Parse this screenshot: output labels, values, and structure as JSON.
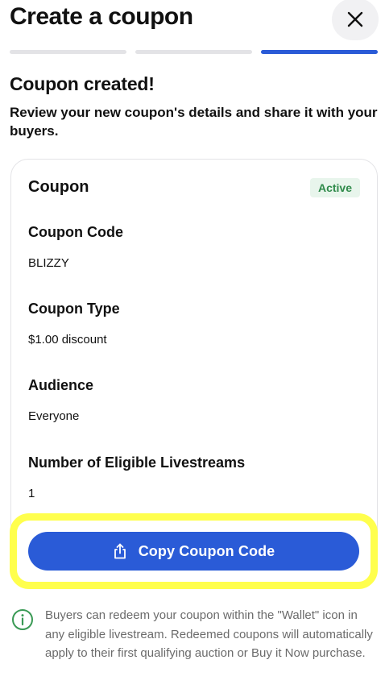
{
  "header": {
    "title": "Create a coupon",
    "close_icon": "close-icon"
  },
  "progress": {
    "total_steps": 3,
    "current_step": 3
  },
  "success": {
    "title": "Coupon created!",
    "description": "Review your new coupon's details and share it with your buyers."
  },
  "coupon": {
    "heading": "Coupon",
    "status": "Active",
    "fields": [
      {
        "label": "Coupon Code",
        "value": "BLIZZY"
      },
      {
        "label": "Coupon Type",
        "value": "$1.00 discount"
      },
      {
        "label": "Audience",
        "value": "Everyone"
      },
      {
        "label": "Number of Eligible Livestreams",
        "value": "1"
      }
    ]
  },
  "copy_button": {
    "label": "Copy Coupon Code",
    "icon": "share-icon"
  },
  "info": {
    "icon": "info-icon",
    "text": "Buyers can redeem your coupon within the \"Wallet\" icon in any eligible livestream. Redeemed coupons will automatically apply to their first qualifying auction or Buy it Now purchase."
  },
  "colors": {
    "accent": "#2a5bd7",
    "active_badge_bg": "#e8f5ec",
    "active_badge_text": "#2f8a4a",
    "highlight": "#ffff4d",
    "info_icon": "#3a9a55"
  }
}
